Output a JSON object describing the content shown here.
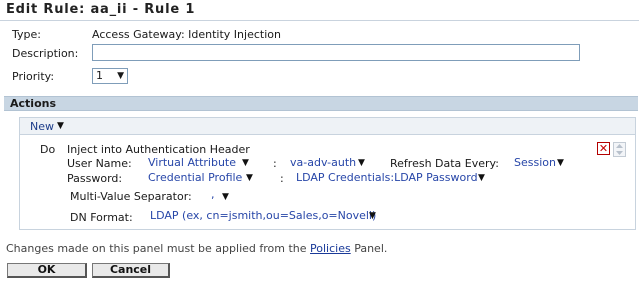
{
  "title": "Edit Rule:  aa_ii - Rule 1",
  "form": {
    "type_label": "Type:",
    "type_value": "Access Gateway: Identity Injection",
    "description_label": "Description:",
    "description_value": "",
    "priority_label": "Priority:",
    "priority_value": "1"
  },
  "actions": {
    "header": "Actions",
    "new_label": "New",
    "do_label": "Do",
    "action_title": "Inject into Authentication Header",
    "username_label": "User Name:",
    "username_source": "Virtual Attribute",
    "colon": ":",
    "username_value": "va-adv-auth",
    "refresh_label": "Refresh Data Every:",
    "refresh_value": "Session",
    "password_label": "Password:",
    "password_source": "Credential Profile",
    "password_value": "LDAP Credentials:LDAP Password",
    "multivalue_label": "Multi-Value Separator:",
    "multivalue_value": ",",
    "dn_label": "DN Format:",
    "dn_value": "LDAP (ex, cn=jsmith,ou=Sales,o=Novell)",
    "delete_glyph": "✕"
  },
  "footer": {
    "note_before": "Changes made on this panel must be applied from the",
    "note_link": "Policies",
    "note_after": "Panel.",
    "ok_label": "OK",
    "cancel_label": "Cancel"
  },
  "colors": {
    "actions_bar": "#c8d6e3",
    "link": "#2746a8",
    "delete_red": "#c40000"
  }
}
